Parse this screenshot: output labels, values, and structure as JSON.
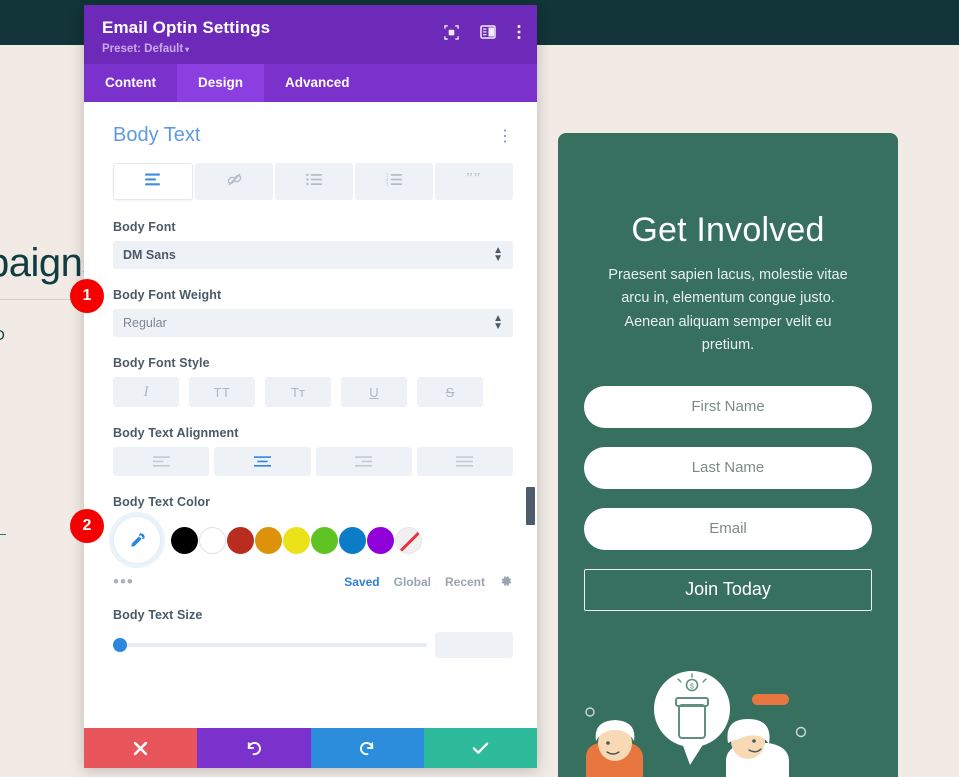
{
  "background": {
    "topbar_color": "#113538",
    "page_color": "#f2ebe5",
    "heading_partial": "Campaigns",
    "snippet_left_1": "D",
    "snippet_left_2": "—",
    "optin_preview": {
      "card_color": "#37705f",
      "title": "Get Involved",
      "description": "Praesent sapien lacus, molestie vitae arcu in, elementum congue justo. Aenean aliquam semper velit eu pretium.",
      "fields": [
        {
          "placeholder": "First Name"
        },
        {
          "placeholder": "Last Name"
        },
        {
          "placeholder": "Email"
        }
      ],
      "submit_label": "Join Today",
      "illustration": "two-people-donation-jar-illustration"
    }
  },
  "modal": {
    "title": "Email Optin Settings",
    "preset_label": "Preset: Default",
    "preset_caret": "▾",
    "header_icons": [
      {
        "name": "focus-target-icon"
      },
      {
        "name": "panel-layout-icon"
      },
      {
        "name": "kebab-menu-icon"
      }
    ],
    "tabs": [
      {
        "label": "Content",
        "active": false
      },
      {
        "label": "Design",
        "active": true
      },
      {
        "label": "Advanced",
        "active": false
      }
    ],
    "section": {
      "title": "Body Text",
      "kebab": "⋮",
      "icon_tabs": [
        {
          "name": "body-text-icon",
          "active": true
        },
        {
          "name": "link-icon",
          "active": false
        },
        {
          "name": "unordered-list-icon",
          "active": false
        },
        {
          "name": "ordered-list-icon",
          "active": false
        },
        {
          "name": "blockquote-icon",
          "active": false
        }
      ],
      "fields": {
        "body_font": {
          "label": "Body Font",
          "value": "DM Sans"
        },
        "body_font_weight": {
          "label": "Body Font Weight",
          "value": "Regular"
        },
        "body_font_style": {
          "label": "Body Font Style",
          "options": [
            {
              "name": "italic-icon",
              "glyph": "I",
              "active": false
            },
            {
              "name": "uppercase-icon",
              "glyph": "TT",
              "active": false
            },
            {
              "name": "capitalize-icon",
              "glyph": "Tᴛ",
              "active": false
            },
            {
              "name": "underline-icon",
              "glyph": "U",
              "active": false
            },
            {
              "name": "strikethrough-icon",
              "glyph": "S",
              "active": false
            }
          ]
        },
        "body_text_alignment": {
          "label": "Body Text Alignment",
          "options": [
            {
              "name": "align-left-icon",
              "active": false
            },
            {
              "name": "align-center-icon",
              "active": true
            },
            {
              "name": "align-right-icon",
              "active": false
            },
            {
              "name": "align-justify-icon",
              "active": false
            }
          ]
        },
        "body_text_color": {
          "label": "Body Text Color",
          "eyedropper": "eyedropper-icon",
          "swatches": [
            {
              "name": "swatch-black",
              "color": "#000000"
            },
            {
              "name": "swatch-white",
              "color": "#ffffff"
            },
            {
              "name": "swatch-dark-red",
              "color": "#b92c20"
            },
            {
              "name": "swatch-orange",
              "color": "#dd9209"
            },
            {
              "name": "swatch-yellow",
              "color": "#ece21a"
            },
            {
              "name": "swatch-green",
              "color": "#60c324"
            },
            {
              "name": "swatch-blue",
              "color": "#0b7cc6"
            },
            {
              "name": "swatch-purple",
              "color": "#9000db"
            },
            {
              "name": "swatch-transparent",
              "color": "transparent"
            }
          ],
          "more_dots": "•••",
          "tabs": [
            {
              "label": "Saved",
              "active": true
            },
            {
              "label": "Global",
              "active": false
            },
            {
              "label": "Recent",
              "active": false
            }
          ],
          "settings_icon": "gear-icon"
        },
        "body_text_size": {
          "label": "Body Text Size"
        }
      }
    },
    "footer": [
      {
        "name": "cancel-button",
        "glyph": "✖",
        "color": "#e8555a"
      },
      {
        "name": "undo-button",
        "glyph": "↺",
        "color": "#7b31cc"
      },
      {
        "name": "redo-button",
        "glyph": "↻",
        "color": "#2b8ddb"
      },
      {
        "name": "save-button",
        "glyph": "✔",
        "color": "#2ebb9b"
      }
    ]
  },
  "annotations": [
    {
      "label": "1"
    },
    {
      "label": "2"
    }
  ]
}
